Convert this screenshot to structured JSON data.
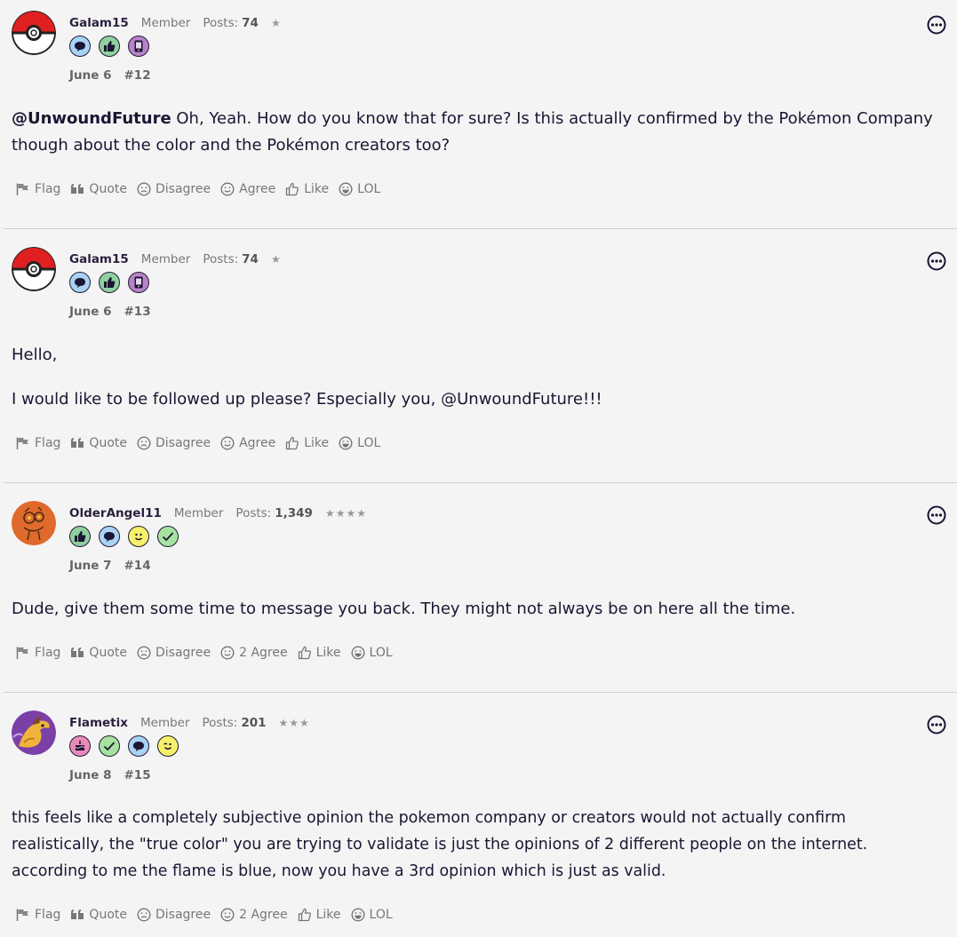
{
  "posts": [
    {
      "username": "Galam15",
      "role": "Member",
      "posts_label": "Posts:",
      "posts_count": "74",
      "stars": "★",
      "avatar": "pokeball",
      "badges": [
        "speech-bubble-badge",
        "thumbs-up-badge",
        "phone-badge"
      ],
      "date": "June 6",
      "number": "#12",
      "mention": "@UnwoundFuture",
      "text": " Oh, Yeah. How do you know that for sure? Is this actually confirmed by the Pokémon Company though about the color and the Pokémon creators too?",
      "actions": {
        "flag": "Flag",
        "quote": "Quote",
        "disagree": "Disagree",
        "agree": "Agree",
        "like": "Like",
        "lol": "LOL"
      }
    },
    {
      "username": "Galam15",
      "role": "Member",
      "posts_label": "Posts:",
      "posts_count": "74",
      "stars": "★",
      "avatar": "pokeball",
      "badges": [
        "speech-bubble-badge",
        "thumbs-up-badge",
        "phone-badge"
      ],
      "date": "June 6",
      "number": "#13",
      "paragraph1": "Hello,",
      "paragraph2": "I would like to be followed up please? Especially you, @UnwoundFuture!!!",
      "actions": {
        "flag": "Flag",
        "quote": "Quote",
        "disagree": "Disagree",
        "agree": "Agree",
        "like": "Like",
        "lol": "LOL"
      }
    },
    {
      "username": "OlderAngel11",
      "role": "Member",
      "posts_label": "Posts:",
      "posts_count": "1,349",
      "stars": "★★★★",
      "avatar": "orange-sketch",
      "badges": [
        "thumbs-up-badge",
        "speech-bubble-badge",
        "smiley-badge",
        "checkmark-badge"
      ],
      "date": "June 7",
      "number": "#14",
      "text": "Dude, give them some time to message you back. They might not always be on here all the time.",
      "actions": {
        "flag": "Flag",
        "quote": "Quote",
        "disagree": "Disagree",
        "agree": "2 Agree",
        "like": "Like",
        "lol": "LOL"
      }
    },
    {
      "username": "Flametix",
      "role": "Member",
      "posts_label": "Posts:",
      "posts_count": "201",
      "stars": "★★★",
      "avatar": "purple-dragon",
      "badges": [
        "cake-badge",
        "checkmark-badge",
        "speech-bubble-badge",
        "wink-badge"
      ],
      "date": "June 8",
      "number": "#15",
      "text": "this feels like a completely subjective opinion the pokemon company or creators would not actually confirm realistically, the \"true color\" you are trying to validate is just the opinions of 2 different people on the internet. according to me the flame is blue, now you have a 3rd opinion which is just as valid.",
      "actions": {
        "flag": "Flag",
        "quote": "Quote",
        "disagree": "Disagree",
        "agree": "2 Agree",
        "like": "Like",
        "lol": "LOL"
      }
    }
  ],
  "colors": {
    "background": "#f4f4f4",
    "text": "#1c1533",
    "muted": "#777777",
    "divider": "#cfcfcf"
  }
}
